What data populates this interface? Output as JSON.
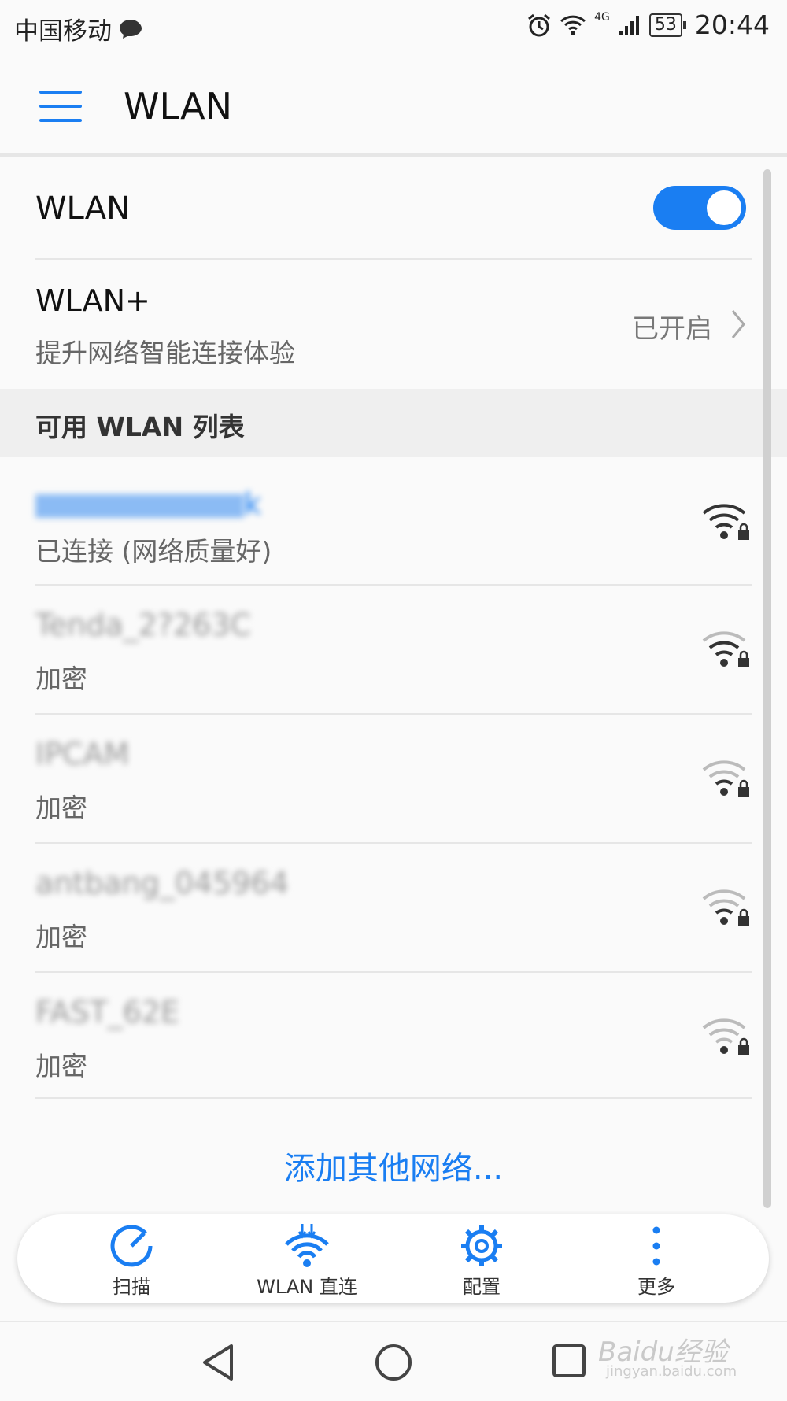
{
  "status_bar": {
    "carrier": "中国移动",
    "network_type": "4G",
    "battery": "53",
    "time": "20:44"
  },
  "app_bar": {
    "title": "WLAN"
  },
  "wlan_toggle": {
    "label": "WLAN",
    "state": "on"
  },
  "wlan_plus": {
    "title": "WLAN+",
    "subtitle": "提升网络智能连接体验",
    "status": "已开启"
  },
  "section": {
    "title": "可用 WLAN 列表"
  },
  "networks": [
    {
      "name": "k",
      "status": "已连接 (网络质量好)"
    },
    {
      "name": "Tenda_2?263C",
      "status": "加密"
    },
    {
      "name": "IPCAM",
      "status": "加密"
    },
    {
      "name": "antbang_045964",
      "status": "加密"
    },
    {
      "name": "FAST_62E",
      "status": "加密"
    }
  ],
  "add_network": {
    "label": "添加其他网络..."
  },
  "toolbar": {
    "scan_label": "扫描",
    "direct_label": "WLAN 直连",
    "config_label": "配置",
    "more_label": "更多"
  },
  "watermark": {
    "main": "Baidu经验",
    "sub": "jingyan.baidu.com"
  },
  "colors": {
    "accent": "#1a7ef2"
  }
}
